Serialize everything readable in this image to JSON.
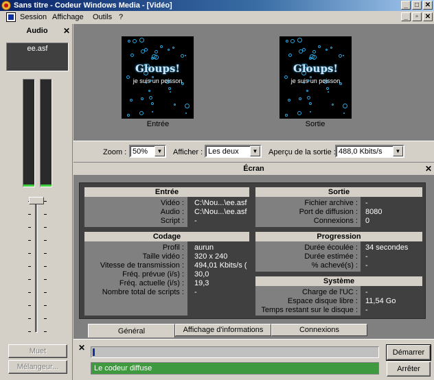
{
  "window": {
    "title": "Sans titre - Codeur Windows Media - [Vidéo]",
    "min": "_",
    "max": "□",
    "close": "✕",
    "mdi_min": "_",
    "mdi_restore": "▫",
    "mdi_close": "✕"
  },
  "menu": [
    "Session",
    "Affichage",
    "Outils",
    "?"
  ],
  "audio": {
    "header": "Audio",
    "close": "✕",
    "file": "ee.asf",
    "mute_button": "Muet",
    "mixer_button": "Mélangeur..."
  },
  "video": {
    "input_label": "Entrée",
    "output_label": "Sortie",
    "clip_title": "Gloups!",
    "clip_subtitle": "je suis un poisson"
  },
  "toolbar": {
    "zoom_label": "Zoom :",
    "zoom_value": "50%",
    "show_label": "Afficher :",
    "show_value": "Les deux",
    "preview_label": "Aperçu de la sortie :",
    "preview_value": "488,0 Kbits/s"
  },
  "screen": {
    "header": "Écran",
    "close": "✕"
  },
  "entree": {
    "title": "Entrée",
    "rows": [
      {
        "label": "Vidéo :",
        "value": "C:\\Nou...\\ee.asf"
      },
      {
        "label": "Audio :",
        "value": "C:\\Nou...\\ee.asf"
      },
      {
        "label": "Script :",
        "value": "-"
      }
    ]
  },
  "sortie": {
    "title": "Sortie",
    "rows": [
      {
        "label": "Fichier archive :",
        "value": "-"
      },
      {
        "label": "Port de diffusion :",
        "value": "8080"
      },
      {
        "label": "Connexions :",
        "value": "0"
      }
    ]
  },
  "codage": {
    "title": "Codage",
    "rows": [
      {
        "label": "Profil :",
        "value": "aurun"
      },
      {
        "label": "Taille vidéo :",
        "value": "320 x 240"
      },
      {
        "label": "Vitesse de transmission :",
        "value": "494,01 Kbits/s ("
      },
      {
        "label": "Fréq. prévue (i/s) :",
        "value": "30,0"
      },
      {
        "label": "Fréq. actuelle (i/s) :",
        "value": "19,3"
      },
      {
        "label": "Nombre total de scripts :",
        "value": "-"
      }
    ]
  },
  "progression": {
    "title": "Progression",
    "rows": [
      {
        "label": "Durée écoulée :",
        "value": "34 secondes"
      },
      {
        "label": "Durée estimée :",
        "value": "-"
      },
      {
        "label": "% achevé(s) :",
        "value": "-"
      }
    ]
  },
  "systeme": {
    "title": "Système",
    "rows": [
      {
        "label": "Charge de l'UC :",
        "value": "-"
      },
      {
        "label": "Espace disque libre :",
        "value": "11,54 Go"
      },
      {
        "label": "Temps restant sur le disque :",
        "value": "-"
      }
    ]
  },
  "tabs": [
    "Général",
    "Affichage d'informations",
    "Connexions"
  ],
  "bottom": {
    "close": "✕",
    "status": "Le codeur diffuse",
    "start_button": "Démarrer",
    "stop_button": "Arrêter"
  }
}
